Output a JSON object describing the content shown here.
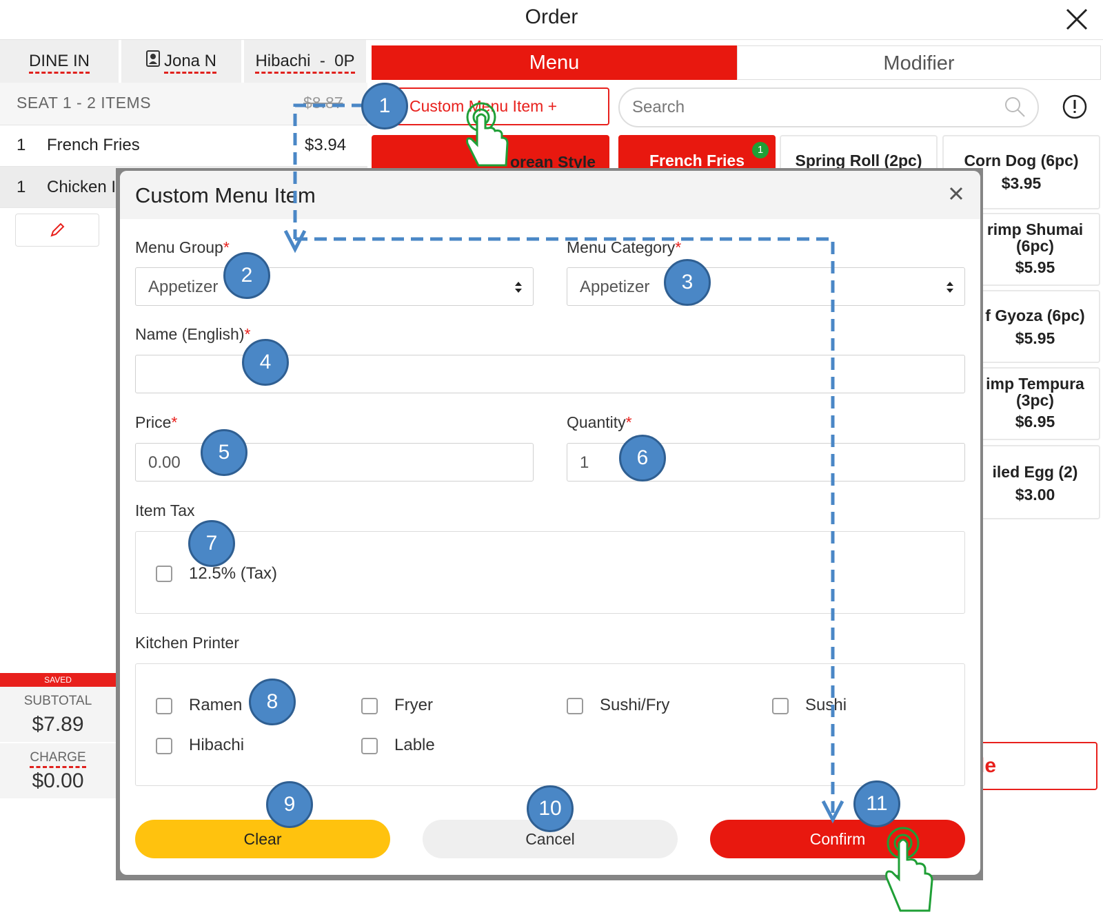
{
  "header": {
    "title": "Order"
  },
  "left": {
    "tabs": [
      {
        "label": "DINE IN"
      },
      {
        "label": "Jona N"
      },
      {
        "label": "Hibachi  -  0P"
      }
    ],
    "seat": {
      "label": "SEAT 1 - 2 ITEMS",
      "total": "$8.87"
    },
    "items": [
      {
        "qty": "1",
        "name": "French Fries",
        "price": "$3.94"
      },
      {
        "qty": "1",
        "name": "Chicken I",
        "price": ""
      }
    ],
    "saved_label": "SAVED",
    "subtotal": {
      "label": "SUBTOTAL",
      "value": "$7.89"
    },
    "charge": {
      "label": "CHARGE",
      "value": "$0.00"
    }
  },
  "right": {
    "tabs": {
      "menu": "Menu",
      "modifier": "Modifier"
    },
    "custom_button": "Custom Menu Item  +",
    "search_placeholder": "Search",
    "tiles": [
      {
        "name": "orean Style",
        "price": "",
        "selected": false
      },
      {
        "name": "French Fries",
        "price": "",
        "selected": true,
        "badge": "1"
      },
      {
        "name": "Spring Roll (2pc)",
        "price": ""
      },
      {
        "name": "Corn Dog (6pc)",
        "price": "$3.95"
      },
      {
        "name": "rimp Shumai (6pc)",
        "price": "$5.95"
      },
      {
        "name": "f Gyoza (6pc)",
        "price": "$5.95"
      },
      {
        "name": "imp Tempura (3pc)",
        "price": "$6.95"
      },
      {
        "name": "iled Egg (2)",
        "price": "$3.00"
      }
    ],
    "bottom_tile": "tle"
  },
  "modal": {
    "title": "Custom Menu Item",
    "menu_group": {
      "label": "Menu Group",
      "value": "Appetizer"
    },
    "menu_category": {
      "label": "Menu Category",
      "value": "Appetizer"
    },
    "name_english": {
      "label": "Name (English)",
      "value": ""
    },
    "price": {
      "label": "Price",
      "value": "0.00"
    },
    "quantity": {
      "label": "Quantity",
      "value": "1"
    },
    "item_tax": {
      "label": "Item Tax",
      "option": "12.5% (Tax)"
    },
    "kitchen_printer": {
      "label": "Kitchen Printer",
      "options": [
        "Ramen",
        "Fryer",
        "Sushi/Fry",
        "Sushi",
        "Hibachi",
        "Lable"
      ]
    },
    "buttons": {
      "clear": "Clear",
      "cancel": "Cancel",
      "confirm": "Confirm"
    }
  },
  "steps": [
    "1",
    "2",
    "3",
    "4",
    "5",
    "6",
    "7",
    "8",
    "9",
    "10",
    "11"
  ],
  "colors": {
    "accent": "#e8180f",
    "step_badge": "#4a87c6",
    "clear_button": "#ffc20e",
    "tap_hand": "#1f9f36"
  }
}
